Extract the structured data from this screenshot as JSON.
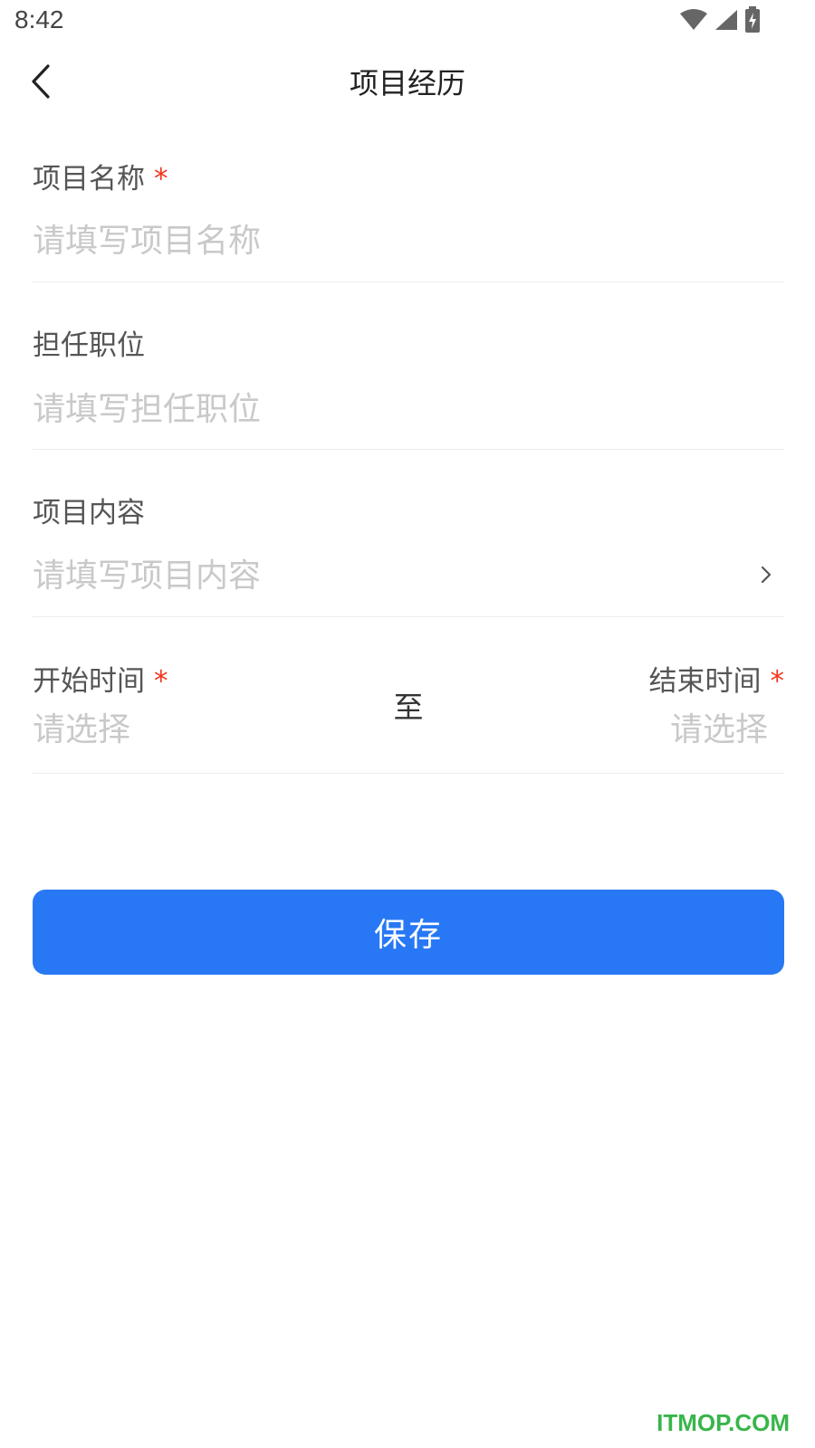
{
  "status_bar": {
    "time": "8:42",
    "icons": [
      "wifi-icon",
      "cell-signal-icon",
      "battery-charging-icon"
    ]
  },
  "nav": {
    "back_icon": "chevron-left-icon",
    "title": "项目经历"
  },
  "form": {
    "project_name": {
      "label": "项目名称",
      "required": true,
      "placeholder": "请填写项目名称",
      "value": ""
    },
    "position": {
      "label": "担任职位",
      "required": false,
      "placeholder": "请填写担任职位",
      "value": ""
    },
    "content": {
      "label": "项目内容",
      "required": false,
      "placeholder": "请填写项目内容",
      "chevron_icon": "chevron-right-icon"
    },
    "dates": {
      "start_label": "开始时间",
      "start_placeholder": "请选择",
      "separator": "至",
      "end_label": "结束时间",
      "end_placeholder": "请选择",
      "required": true
    },
    "required_mark": "*"
  },
  "actions": {
    "save_label": "保存"
  },
  "colors": {
    "accent": "#2878f5",
    "required": "#f0361d",
    "placeholder": "#c9c9c9",
    "watermark": "#39b54a"
  },
  "watermark": "ITMOP.COM"
}
